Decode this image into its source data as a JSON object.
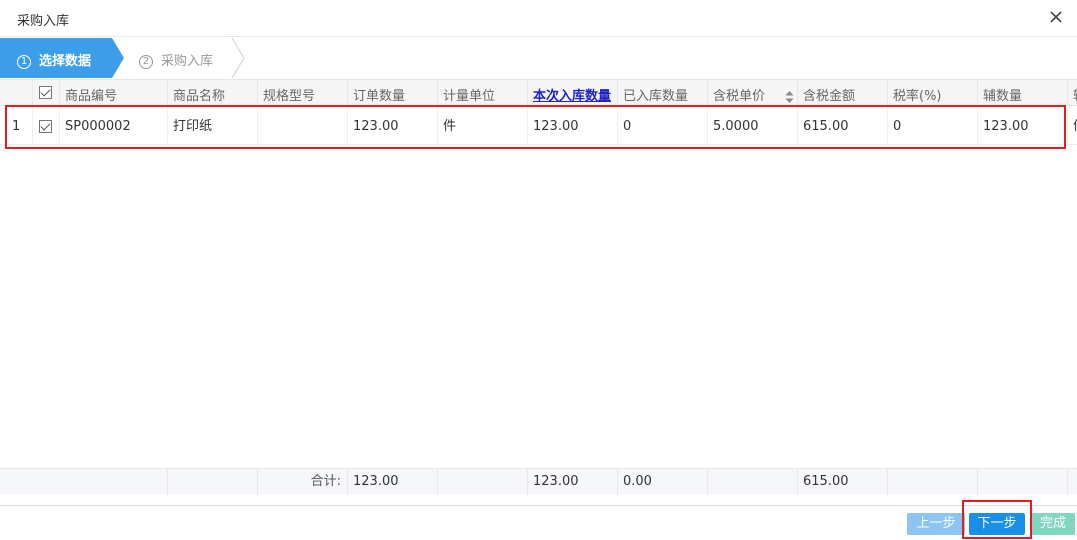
{
  "dialog": {
    "title": "采购入库"
  },
  "steps": [
    {
      "num": "1",
      "label": "选择数据"
    },
    {
      "num": "2",
      "label": "采购入库"
    }
  ],
  "colors": {
    "step_active": "#3c9ee8",
    "primary": "#1890e8",
    "highlight": "#e02020"
  },
  "columns": [
    "商品编号",
    "商品名称",
    "规格型号",
    "订单数量",
    "计量单位",
    "本次入库数量",
    "已入库数量",
    "含税单价",
    "含税金额",
    "税率(%)",
    "辅数量",
    "辅"
  ],
  "rows": [
    {
      "index": "1",
      "checked": true,
      "code": "SP000002",
      "name": "打印纸",
      "spec": "",
      "order_qty": "123.00",
      "unit": "件",
      "in_qty": "123.00",
      "received_qty": "0",
      "unit_price": "5.0000",
      "amount": "615.00",
      "tax_rate": "0",
      "aux_qty": "123.00",
      "aux_unit": "件"
    }
  ],
  "totals": {
    "label": "合计:",
    "order_qty": "123.00",
    "in_qty": "123.00",
    "received_qty": "0.00",
    "amount": "615.00"
  },
  "buttons": {
    "prev": "上一步",
    "next": "下一步",
    "done": "完成"
  }
}
